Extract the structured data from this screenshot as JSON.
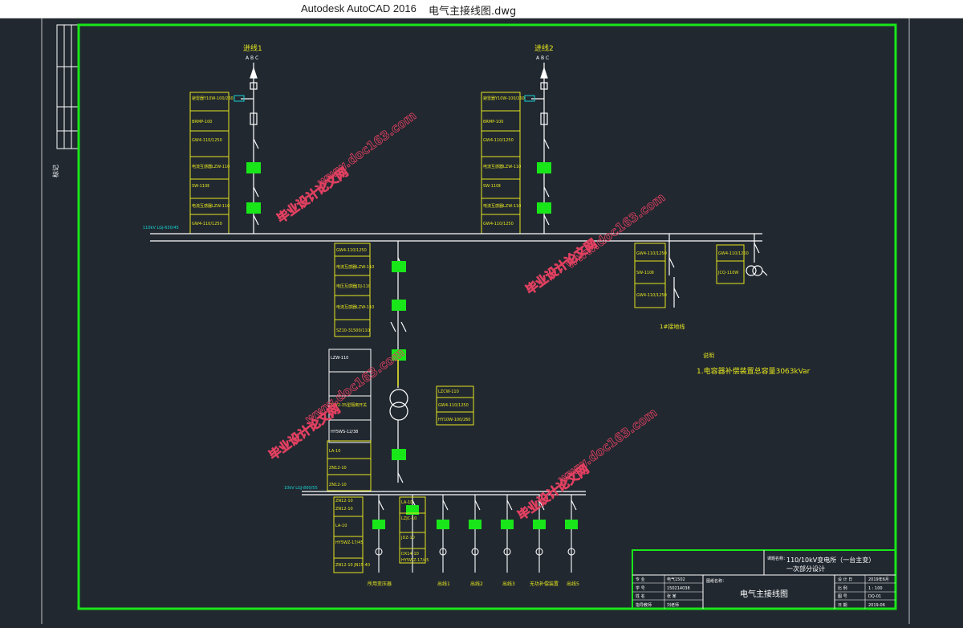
{
  "window": {
    "app_name": "Autodesk AutoCAD 2016",
    "file_name": "电气主接线图.dwg"
  },
  "colors": {
    "background": "#212830",
    "frame": "#19e619",
    "lines": "#ffffff",
    "label_boxes": "#e6e61e",
    "cyan_text": "#19d2d2",
    "breakers": "#19e619",
    "watermark": "#e04060"
  },
  "drawing": {
    "incoming_line_1": "进线1",
    "incoming_line_2": "进线2",
    "phase_abc": "A B C",
    "bus_110kv_label": "110kV LGJ-630/45",
    "bus_10kv_label": "10kV LGJ-800/55",
    "equipment_labels_line1": [
      "避雷器Y10W-100/260",
      "BRMP-100",
      "GW4-110/1250",
      "电流互感器LZW-110",
      "SW-110Ⅱ",
      "电流互感器LZW-110",
      "GW4-110/1250"
    ],
    "equipment_labels_line2": [
      "避雷器Y10W-100/260",
      "BRMP-100",
      "GW4-110/1250",
      "电流互感器LZW-110",
      "SW-110Ⅱ",
      "电流互感器LZW-110",
      "GW4-110/1250"
    ],
    "equipment_labels_transformer_hv": [
      "GW4-110/1250",
      "电流互感器LZW-110",
      "电压互感器JDJ-110",
      "电流互感器LZW-110",
      "SZ10-31500/110"
    ],
    "equipment_labels_pt": [
      "GW4-110/1250",
      "SW-110Ⅱ",
      "GW4-110/1250"
    ],
    "equipment_labels_arrester": [
      "GW4-110/1250",
      "JCQ-110W"
    ],
    "grounding_label": "1#接地线",
    "transformer_left_labels": [
      "LZW-110",
      "GW2-35型隔离开关",
      "HY5WS-12/38"
    ],
    "transformer_right_labels": [
      "LZCW-110",
      "GW4-110/1250",
      "HY10W-100/260"
    ],
    "lv_labels": [
      "LA-10",
      "ZN12-10",
      "ZN12-10"
    ],
    "feeder_labels": [
      "ZN12-10",
      "ZN12-10",
      "LA-10",
      "HY5WZ-17/45",
      "LA-10",
      "LZJC-10",
      "JDZ-10",
      "DX14-10",
      "ZN12-10 JN15-40",
      "HY5WZ-17/45"
    ],
    "note_title": "说明",
    "note_text": "1.电容器补偿装置总容量3063kVar",
    "feeder_outputs": [
      "所用变压器",
      "出线1",
      "出线2",
      "出线3",
      "无功补偿装置",
      "出线5"
    ],
    "side_stamp": "标记"
  },
  "title_block": {
    "project_label": "课题名称：",
    "project_title": "110/10kV变电所（一台主变）",
    "project_subtitle": "一次部分设计",
    "drawing_name_label": "图纸名称：",
    "drawing_name": "电气主接线图",
    "rows_left": [
      {
        "k": "专  业",
        "v": "电气1502"
      },
      {
        "k": "学  号",
        "v": "150214038"
      },
      {
        "k": "姓  名",
        "v": "张  某"
      },
      {
        "k": "指导教师",
        "v": "刘老师"
      }
    ],
    "rows_right": [
      {
        "k": "设 计 日",
        "v": "2019年6月"
      },
      {
        "k": "比  例",
        "v": "1 : 100"
      },
      {
        "k": "图  号",
        "v": "DQ-01"
      },
      {
        "k": "日  期",
        "v": "2019-06"
      }
    ]
  },
  "watermark": {
    "site": "www.doc163.com",
    "text": "毕业设计论文网"
  }
}
